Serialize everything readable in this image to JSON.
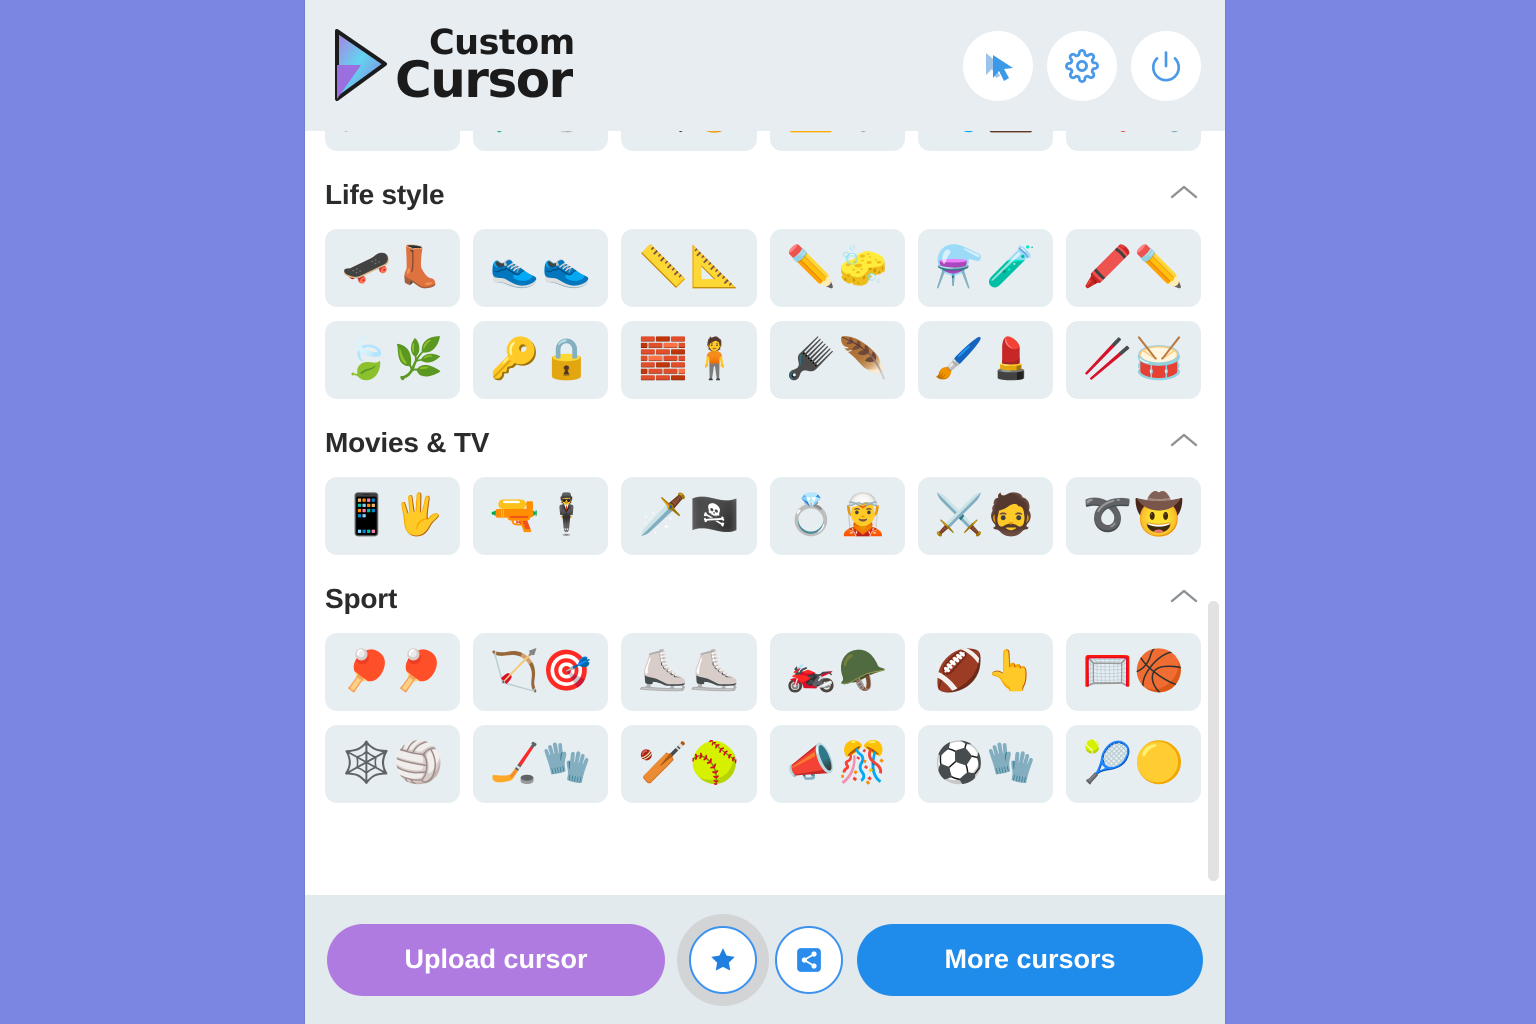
{
  "app": {
    "brand_top": "Custom",
    "brand_bottom": "Cursor",
    "background_color": "#7b86e3",
    "panel_background": "#ffffff",
    "header_background": "#e7edf1",
    "footer_background": "#e3eaee",
    "tile_background": "#e7eef2",
    "accent_blue": "#1f8bea",
    "accent_purple": "#b07be0",
    "icon_blue": "#4a9ae8"
  },
  "header": {
    "buttons": [
      {
        "name": "cursor-toggle-button",
        "icon": "cursor-icon"
      },
      {
        "name": "settings-button",
        "icon": "gear-icon"
      },
      {
        "name": "power-button",
        "icon": "power-icon"
      }
    ]
  },
  "sections": [
    {
      "id": "partial-top",
      "title": "",
      "collapsed": false,
      "rows": [
        [
          {
            "name": "cursor-tile-dagger-mask",
            "g1": "🗡️",
            "g2": "🎭"
          },
          {
            "name": "cursor-tile-razor-barberpole",
            "g1": "🪒",
            "g2": "💈"
          },
          {
            "name": "cursor-tile-magnifier-hat",
            "g1": "🔍",
            "g2": "🤠"
          },
          {
            "name": "cursor-tile-radio-badge",
            "g1": "📻",
            "g2": "🛡️"
          },
          {
            "name": "cursor-tile-stethoscope-bag",
            "g1": "🩺",
            "g2": "💼"
          },
          {
            "name": "cursor-tile-screwdriver-wrench",
            "g1": "🪛",
            "g2": "🔧"
          }
        ]
      ]
    },
    {
      "id": "life-style",
      "title": "Life style",
      "collapsed": false,
      "rows": [
        [
          {
            "name": "cursor-tile-skateboard-boot",
            "g1": "🛹",
            "g2": "👢"
          },
          {
            "name": "cursor-tile-sneakers",
            "g1": "👟",
            "g2": "👟"
          },
          {
            "name": "cursor-tile-ruler-protractor",
            "g1": "📏",
            "g2": "📐"
          },
          {
            "name": "cursor-tile-pencil-eraser",
            "g1": "✏️",
            "g2": "🧽"
          },
          {
            "name": "cursor-tile-flasks",
            "g1": "⚗️",
            "g2": "🧪"
          },
          {
            "name": "cursor-tile-crayon-pencil",
            "g1": "🖍️",
            "g2": "✏️"
          }
        ],
        [
          {
            "name": "cursor-tile-leaves",
            "g1": "🍃",
            "g2": "🌿"
          },
          {
            "name": "cursor-tile-key-lock",
            "g1": "🔑",
            "g2": "🔒"
          },
          {
            "name": "cursor-tile-brick-lego",
            "g1": "🧱",
            "g2": "🧍"
          },
          {
            "name": "cursor-tile-hairbrush-comb",
            "g1": "🪮",
            "g2": "🪶"
          },
          {
            "name": "cursor-tile-makeup-brush-compact",
            "g1": "🖌️",
            "g2": "💄"
          },
          {
            "name": "cursor-tile-drumstick-drum",
            "g1": "🥢",
            "g2": "🥁"
          }
        ]
      ]
    },
    {
      "id": "movies-tv",
      "title": "Movies & TV",
      "collapsed": false,
      "rows": [
        [
          {
            "name": "cursor-tile-phone-hand",
            "g1": "📱",
            "g2": "🖐️"
          },
          {
            "name": "cursor-tile-gun-agent",
            "g1": "🔫",
            "g2": "🕴️"
          },
          {
            "name": "cursor-tile-sword-pirate",
            "g1": "🗡️",
            "g2": "🏴‍☠️"
          },
          {
            "name": "cursor-tile-ring-hobbit",
            "g1": "💍",
            "g2": "🧝"
          },
          {
            "name": "cursor-tile-sword-knight",
            "g1": "⚔️",
            "g2": "🧔"
          },
          {
            "name": "cursor-tile-whip-cowboyhat",
            "g1": "➰",
            "g2": "🤠"
          }
        ]
      ]
    },
    {
      "id": "sport",
      "title": "Sport",
      "collapsed": false,
      "rows": [
        [
          {
            "name": "cursor-tile-pingpong-paddles",
            "g1": "🏓",
            "g2": "🏓"
          },
          {
            "name": "cursor-tile-arrow-target",
            "g1": "🏹",
            "g2": "🎯"
          },
          {
            "name": "cursor-tile-skates",
            "g1": "⛸️",
            "g2": "⛸️"
          },
          {
            "name": "cursor-tile-motorbike-helmet",
            "g1": "🏍️",
            "g2": "🪖"
          },
          {
            "name": "cursor-tile-football-foam-finger",
            "g1": "🏈",
            "g2": "👆"
          },
          {
            "name": "cursor-tile-hoop-basketball",
            "g1": "🥅",
            "g2": "🏀"
          }
        ],
        [
          {
            "name": "cursor-tile-net-volleyball",
            "g1": "🕸️",
            "g2": "🏐"
          },
          {
            "name": "cursor-tile-hockeystick-pads",
            "g1": "🏒",
            "g2": "🧤"
          },
          {
            "name": "cursor-tile-bat-glove",
            "g1": "🏏",
            "g2": "🥎"
          },
          {
            "name": "cursor-tile-megaphone-pompom",
            "g1": "📣",
            "g2": "🎊"
          },
          {
            "name": "cursor-tile-soccer-glove",
            "g1": "⚽",
            "g2": "🧤"
          },
          {
            "name": "cursor-tile-racket-tennisball",
            "g1": "🎾",
            "g2": "🟡"
          }
        ]
      ]
    }
  ],
  "footer": {
    "upload_label": "Upload cursor",
    "more_label": "More cursors",
    "favorites_icon": "star-icon",
    "share_icon": "share-icon"
  }
}
